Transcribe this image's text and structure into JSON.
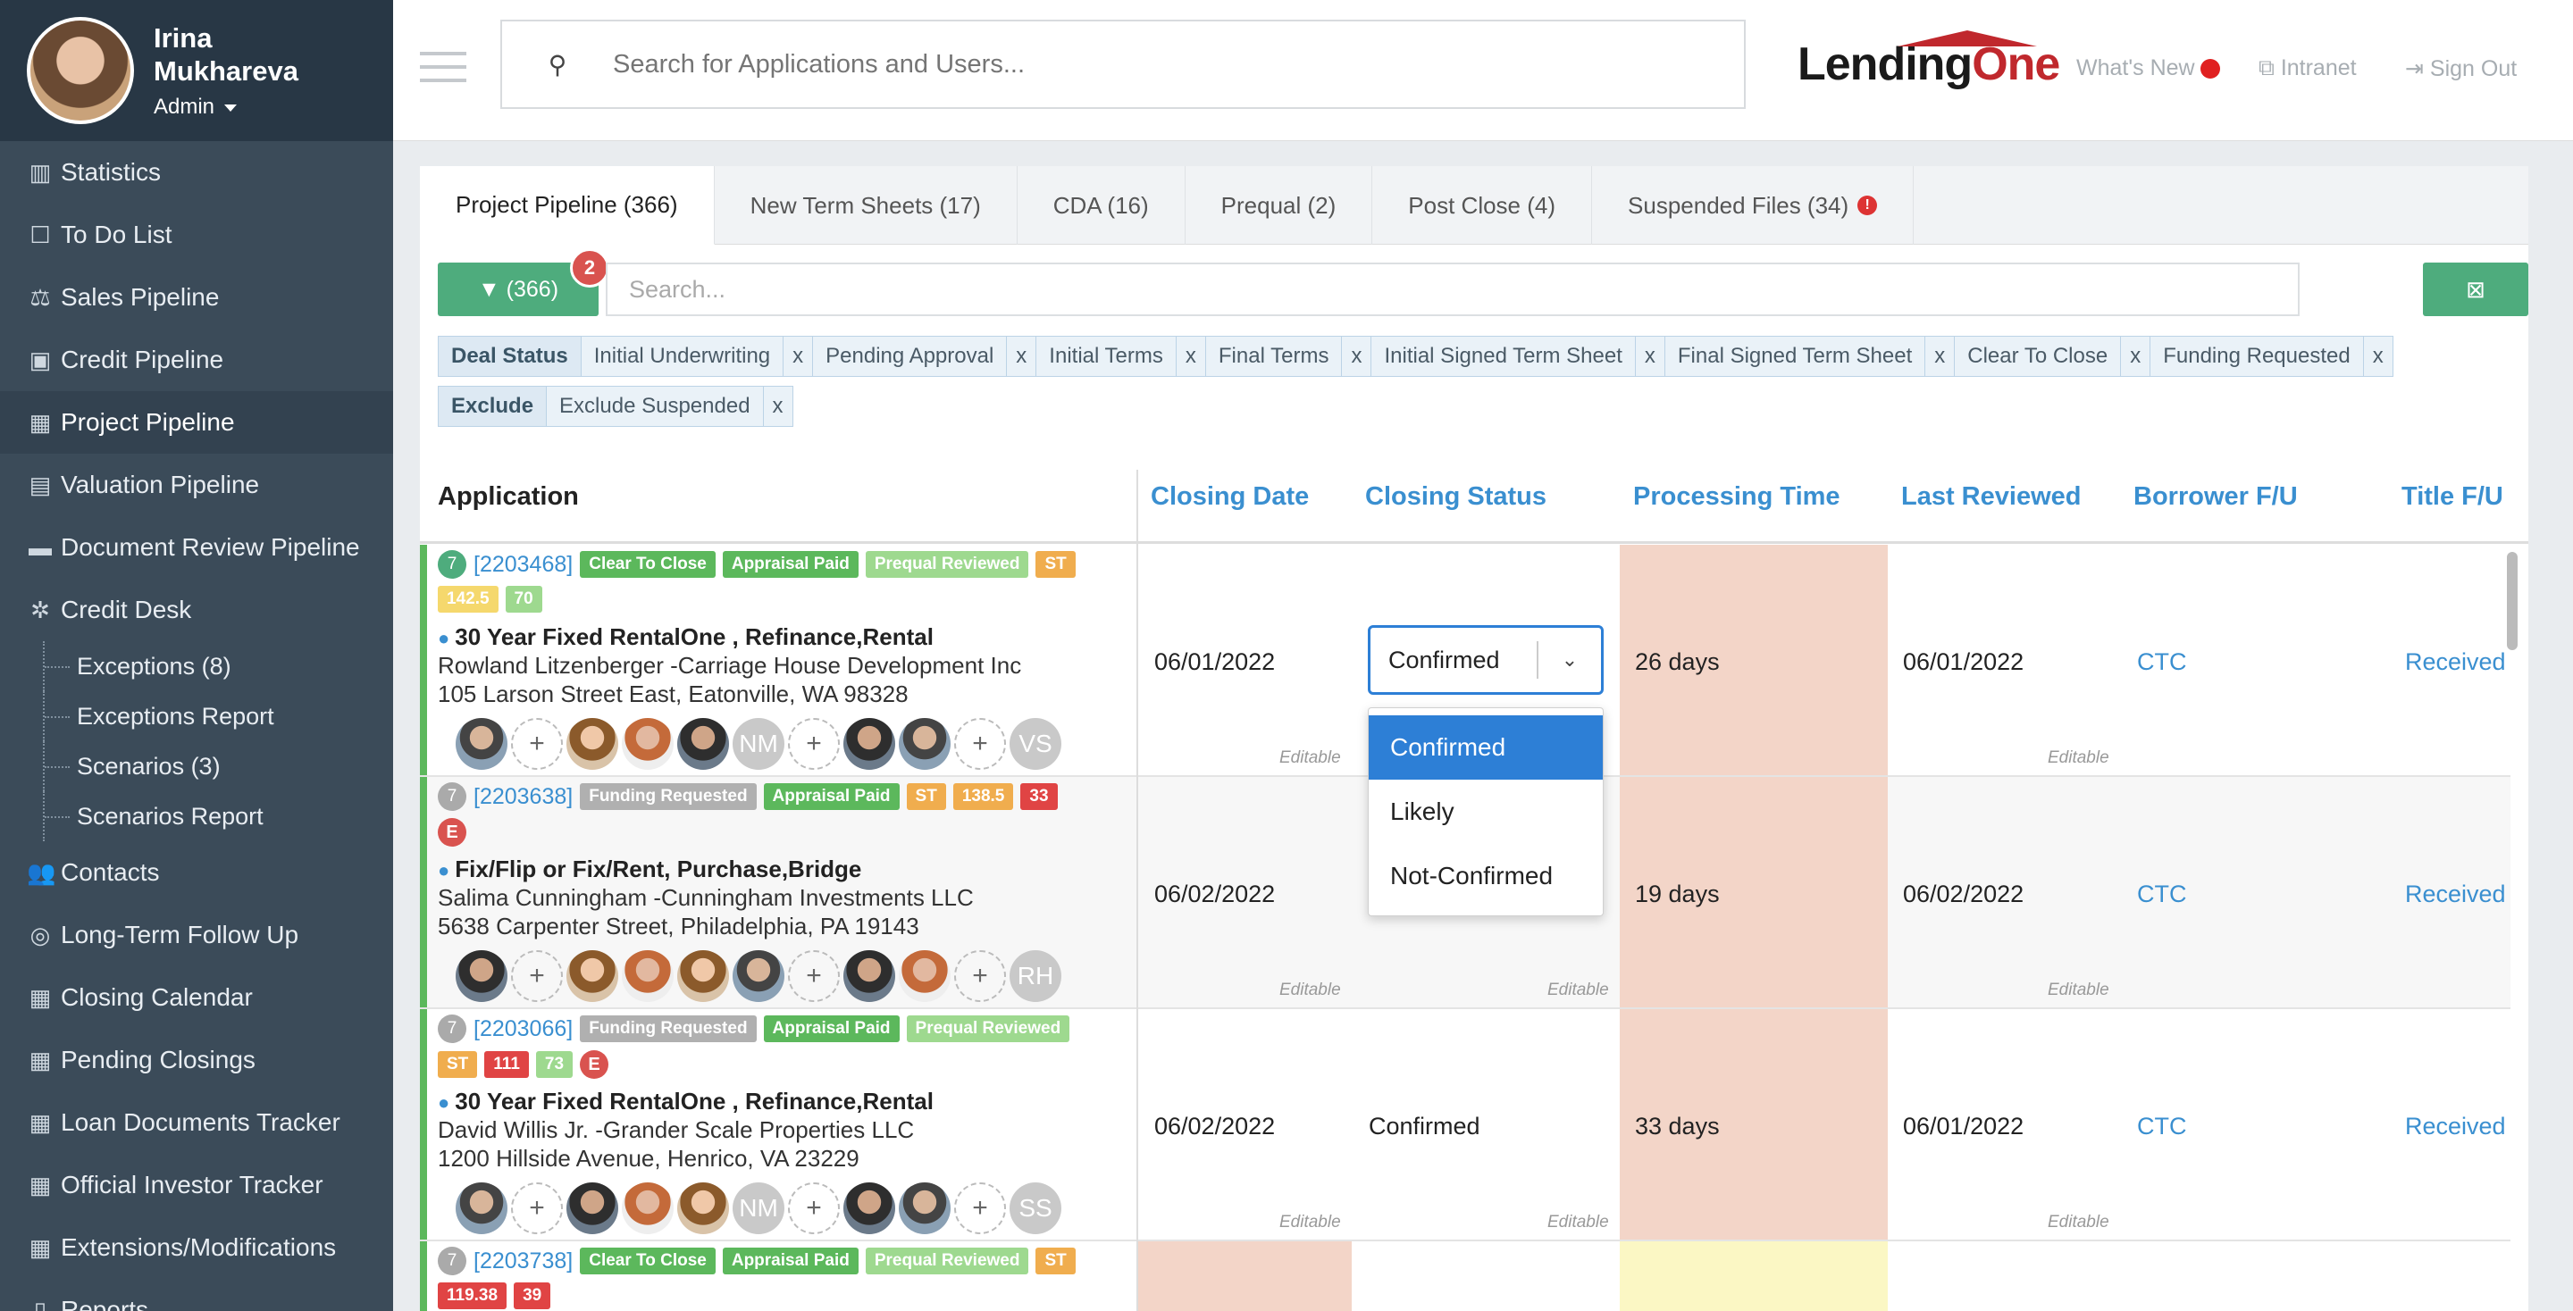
{
  "profile": {
    "name": "Irina Mukhareva",
    "role": "Admin"
  },
  "sidebar": {
    "items": [
      {
        "label": "Statistics",
        "icon": "bar-chart-icon"
      },
      {
        "label": "To Do List",
        "icon": "clipboard-icon"
      },
      {
        "label": "Sales Pipeline",
        "icon": "scale-icon"
      },
      {
        "label": "Credit Pipeline",
        "icon": "briefcase-icon"
      },
      {
        "label": "Project Pipeline",
        "icon": "calendar-icon",
        "active": true
      },
      {
        "label": "Valuation Pipeline",
        "icon": "calculator-icon"
      },
      {
        "label": "Document Review Pipeline",
        "icon": "folder-icon"
      },
      {
        "label": "Credit Desk",
        "icon": "bug-icon"
      }
    ],
    "subitems": [
      "Exceptions (8)",
      "Exceptions Report",
      "Scenarios (3)",
      "Scenarios Report"
    ],
    "items2": [
      {
        "label": "Contacts",
        "icon": "users-icon"
      },
      {
        "label": "Long-Term Follow Up",
        "icon": "lifebuoy-icon"
      },
      {
        "label": "Closing Calendar",
        "icon": "calendar-icon"
      },
      {
        "label": "Pending Closings",
        "icon": "calendar-icon"
      },
      {
        "label": "Loan Documents Tracker",
        "icon": "calendar-icon"
      },
      {
        "label": "Official Investor Tracker",
        "icon": "calendar-icon"
      },
      {
        "label": "Extensions/Modifications",
        "icon": "calendar-icon"
      },
      {
        "label": "Reports",
        "icon": "file-icon"
      }
    ]
  },
  "header": {
    "search_placeholder": "Search for Applications and Users...",
    "logo_a": "Lending",
    "logo_b": "One",
    "whats_new": "What's New",
    "intranet": "Intranet",
    "sign_out": "Sign Out"
  },
  "tabs": [
    "Project Pipeline (366)",
    "New Term Sheets (17)",
    "CDA (16)",
    "Prequal (2)",
    "Post Close (4)",
    "Suspended Files (34)"
  ],
  "toolbar": {
    "filter_count": "(366)",
    "filter_badge": "2",
    "search_placeholder": "Search..."
  },
  "filters": {
    "deal_status_label": "Deal Status",
    "deal_status": [
      "Initial Underwriting",
      "Pending Approval",
      "Initial Terms",
      "Final Terms",
      "Initial Signed Term Sheet",
      "Final Signed Term Sheet",
      "Clear To Close",
      "Funding Requested"
    ],
    "exclude_label": "Exclude",
    "exclude": [
      "Exclude Suspended"
    ],
    "remove_symbol": "x"
  },
  "columns": [
    "Application",
    "Closing Date",
    "Closing Status",
    "Processing Time",
    "Last Reviewed",
    "Borrower F/U",
    "Title F/U"
  ],
  "editable_label": "Editable",
  "rows": [
    {
      "num": "7",
      "id": "[2203468]",
      "tags": [
        "Clear To Close",
        "Appraisal Paid",
        "Prequal Reviewed",
        "ST"
      ],
      "tags2": [
        "142.5",
        "70"
      ],
      "title": "30 Year Fixed RentalOne , Refinance,Rental",
      "borrower": "Rowland Litzenberger -Carriage House Development Inc",
      "address": "105 Larson Street East, Eatonville, WA 98328",
      "initials": [
        "NM",
        "VS"
      ],
      "closing_date": "06/01/2022",
      "closing_status": "Confirmed",
      "processing": "26 days",
      "last_reviewed": "06/01/2022",
      "borrower_fu": "CTC",
      "title_fu": "Received"
    },
    {
      "num": "7",
      "id": "[2203638]",
      "tags": [
        "Funding Requested",
        "Appraisal Paid",
        "ST",
        "138.5",
        "33"
      ],
      "title": "Fix/Flip or Fix/Rent, Purchase,Bridge",
      "borrower": "Salima Cunningham -Cunningham Investments LLC",
      "address": "5638 Carpenter Street, Philadelphia, PA 19143",
      "initials": [
        "RH"
      ],
      "closing_date": "06/02/2022",
      "processing": "19 days",
      "last_reviewed": "06/02/2022",
      "borrower_fu": "CTC",
      "title_fu": "Received"
    },
    {
      "num": "7",
      "id": "[2203066]",
      "tags": [
        "Funding Requested",
        "Appraisal Paid",
        "Prequal Reviewed"
      ],
      "tags2": [
        "ST",
        "111",
        "73"
      ],
      "title": "30 Year Fixed RentalOne , Refinance,Rental",
      "borrower": "David Willis Jr. -Grander Scale Properties LLC",
      "address": "1200 Hillside Avenue, Henrico, VA 23229",
      "initials": [
        "NM",
        "SS"
      ],
      "closing_date": "06/02/2022",
      "closing_status": "Confirmed",
      "processing": "33 days",
      "last_reviewed": "06/01/2022",
      "borrower_fu": "CTC",
      "title_fu": "Received"
    },
    {
      "num": "7",
      "id": "[2203738]",
      "tags": [
        "Clear To Close",
        "Appraisal Paid",
        "Prequal Reviewed",
        "ST"
      ],
      "tags2": [
        "119.38",
        "39"
      ]
    }
  ],
  "dropdown": {
    "value": "Confirmed",
    "options": [
      "Confirmed",
      "Likely",
      "Not-Confirmed"
    ],
    "selected": "Confirmed"
  },
  "e_tag": "E",
  "add_symbol": "+",
  "colors": {
    "accent": "#4eac7d",
    "link": "#3a8fd0",
    "processing_bg": "#f3d5c8",
    "sidebar": "#3b4b59"
  }
}
